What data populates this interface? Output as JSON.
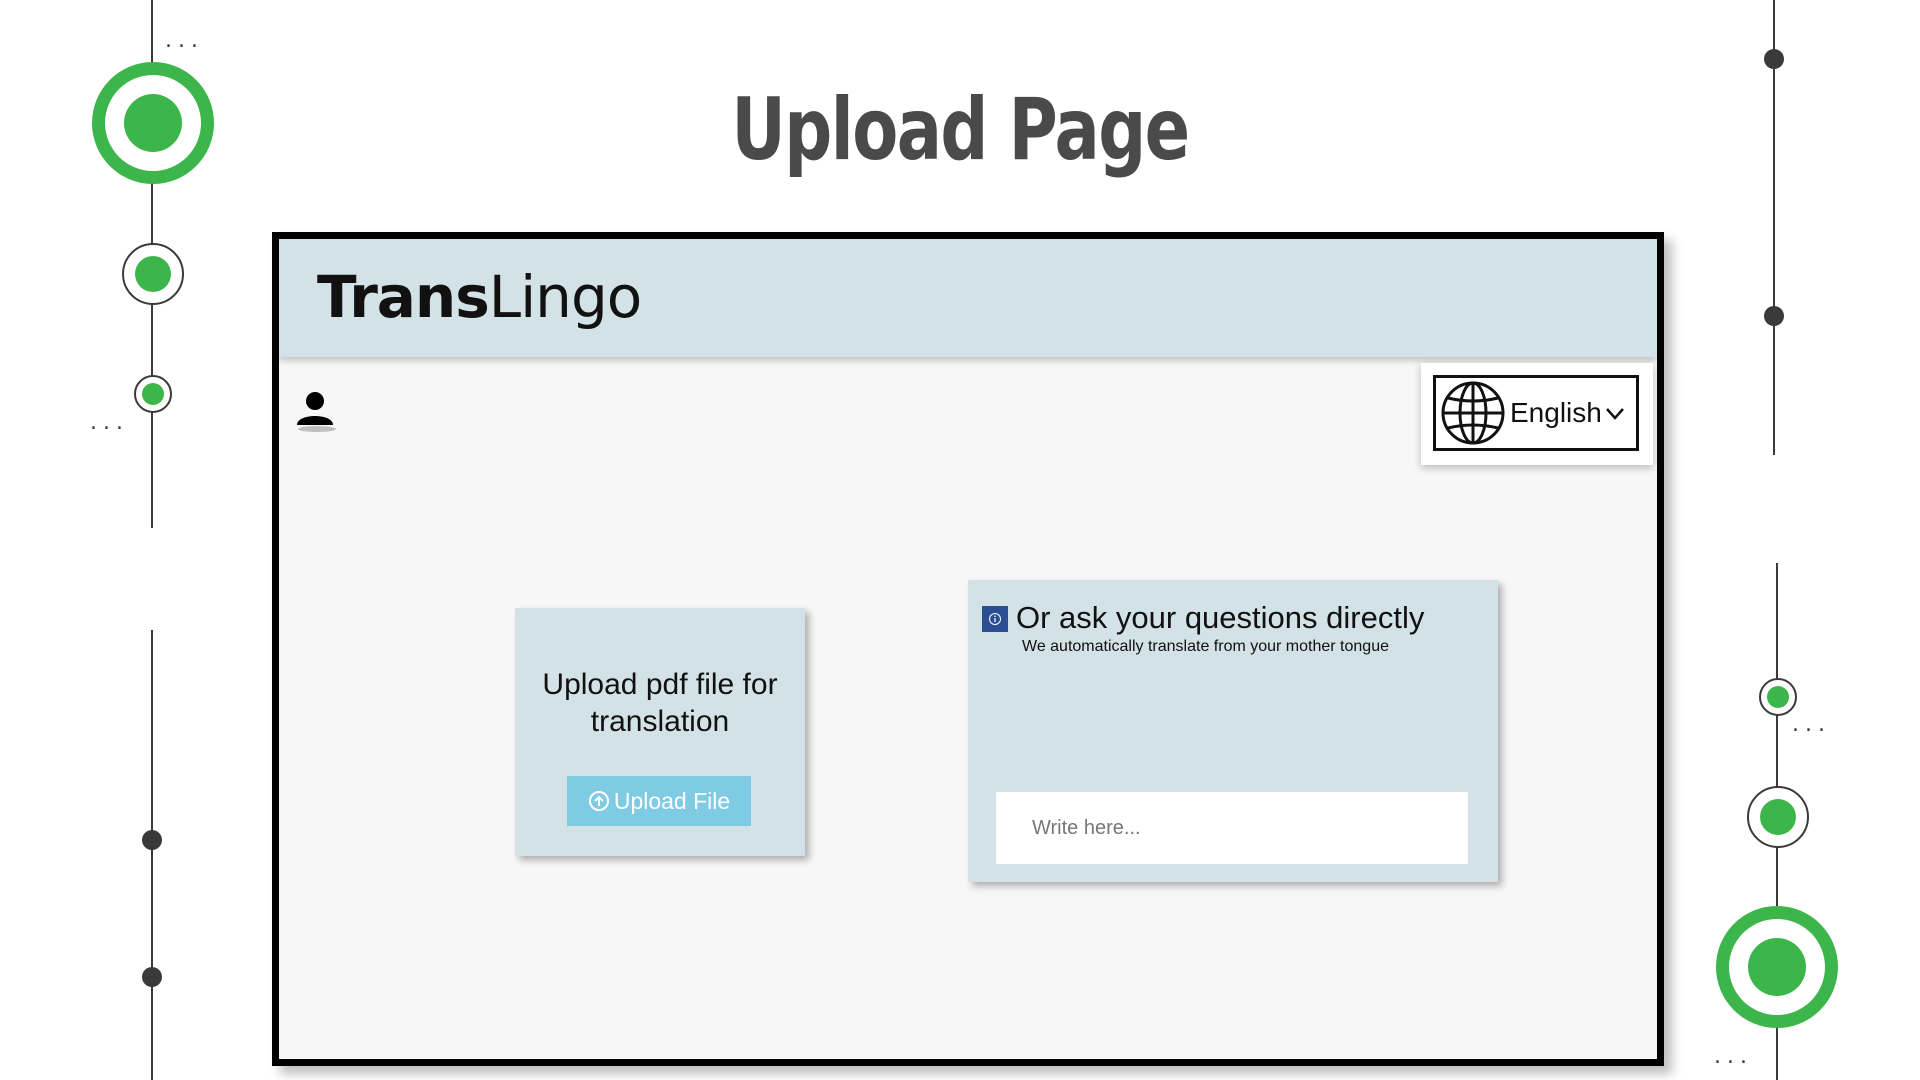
{
  "slide": {
    "title": "Upload Page"
  },
  "decorations": {
    "ellipsis": "..."
  },
  "app": {
    "brand_bold": "Trans",
    "brand_light": "Lingo",
    "language": {
      "selected": "English",
      "icon": "globe-icon"
    },
    "user": {
      "icon": "user-icon"
    }
  },
  "upload_card": {
    "title": "Upload pdf file for translation",
    "button_label": "Upload File",
    "button_icon": "upload-arrow-icon"
  },
  "ask_card": {
    "title": "Or ask your questions directly",
    "subtitle": "We automatically translate from your mother tongue",
    "placeholder": "Write here...",
    "icon": "info-icon"
  },
  "colors": {
    "accent_green": "#3cb54a",
    "panel": "#d2e2e6",
    "upload_button": "#7fcbe4",
    "info_badge": "#2a4e91"
  }
}
